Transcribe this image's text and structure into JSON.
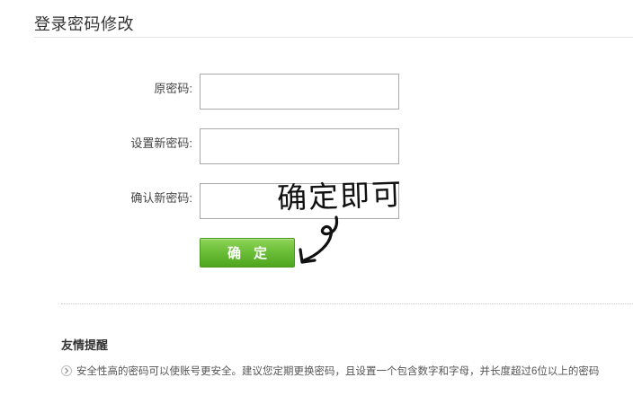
{
  "page": {
    "title": "登录密码修改"
  },
  "form": {
    "old_password_label": "原密码:",
    "new_password_label": "设置新密码:",
    "confirm_password_label": "确认新密码:",
    "old_password_value": "",
    "new_password_value": "",
    "confirm_password_value": "",
    "submit_label": "确定"
  },
  "annotation": {
    "text": "确定即可"
  },
  "tips": {
    "heading": "友情提醒",
    "items": [
      "安全性高的密码可以使账号更安全。建议您定期更换密码，且设置一个包含数字和字母，并长度超过6位以上的密码"
    ]
  },
  "colors": {
    "button_green": "#6cbf38",
    "text_dark": "#333333"
  },
  "icons": {
    "tips_bullet": "chevron-right-circle-icon",
    "annotation_arrow": "curved-arrow-icon"
  }
}
